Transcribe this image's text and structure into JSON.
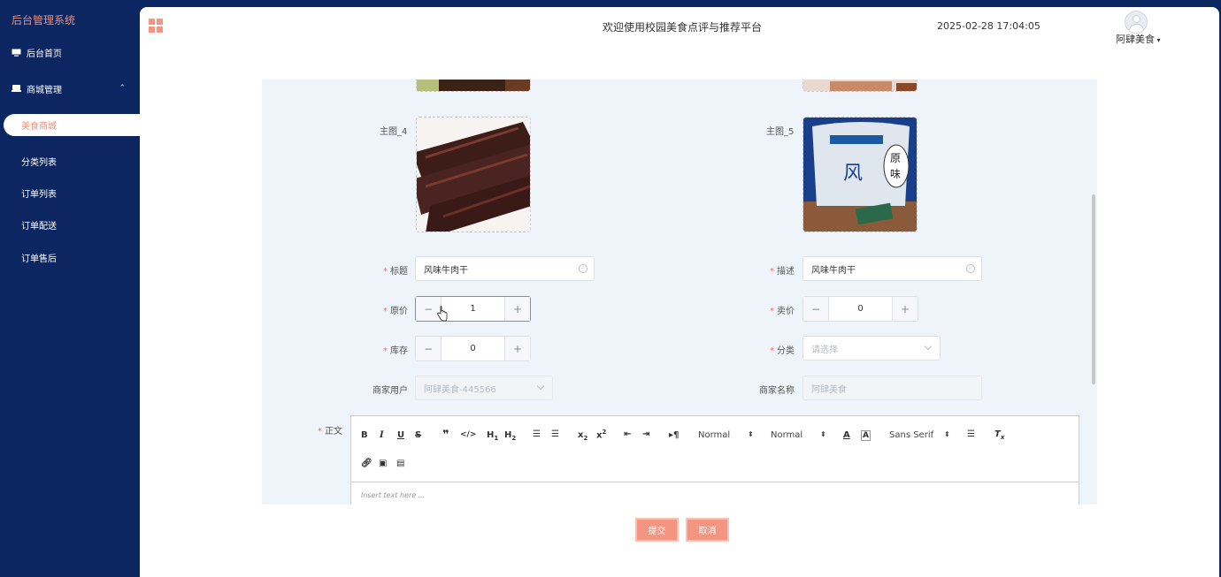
{
  "app": {
    "title": "后台管理系统"
  },
  "sidebar": {
    "items": [
      {
        "label": "后台首页",
        "icon": "monitor-icon"
      },
      {
        "label": "商城管理",
        "icon": "shop-icon"
      }
    ],
    "submenu": [
      {
        "label": "美食商城",
        "active": true
      },
      {
        "label": "分类列表"
      },
      {
        "label": "订单列表"
      },
      {
        "label": "订单配送"
      },
      {
        "label": "订单售后"
      }
    ]
  },
  "header": {
    "welcome": "欢迎使用校园美食点评与推荐平台",
    "datetime": "2025-02-28 17:04:05",
    "username": "阿肆美食"
  },
  "form": {
    "images": {
      "image4_label": "主图_4",
      "image5_label": "主图_5"
    },
    "title": {
      "label": "标题",
      "value": "风味牛肉干"
    },
    "description": {
      "label": "描述",
      "value": "风味牛肉干"
    },
    "original_price": {
      "label": "原价",
      "value": "1"
    },
    "sale_price": {
      "label": "卖价",
      "value": "0"
    },
    "stock": {
      "label": "库存",
      "value": "0"
    },
    "category": {
      "label": "分类",
      "placeholder": "请选择"
    },
    "merchant_user": {
      "label": "商家用户",
      "value": "阿肆美食-445566"
    },
    "merchant_name": {
      "label": "商家名称",
      "value": "阿肆美食"
    },
    "content": {
      "label": "正文",
      "placeholder": "Insert text here ...",
      "header_select": "Normal",
      "size_select": "Normal",
      "font_select": "Sans Serif"
    }
  },
  "actions": {
    "submit": "提交",
    "cancel": "取消"
  },
  "colors": {
    "sidebar_bg": "#0b2660",
    "accent": "#f39580",
    "panel_bg": "#eef4fa"
  }
}
